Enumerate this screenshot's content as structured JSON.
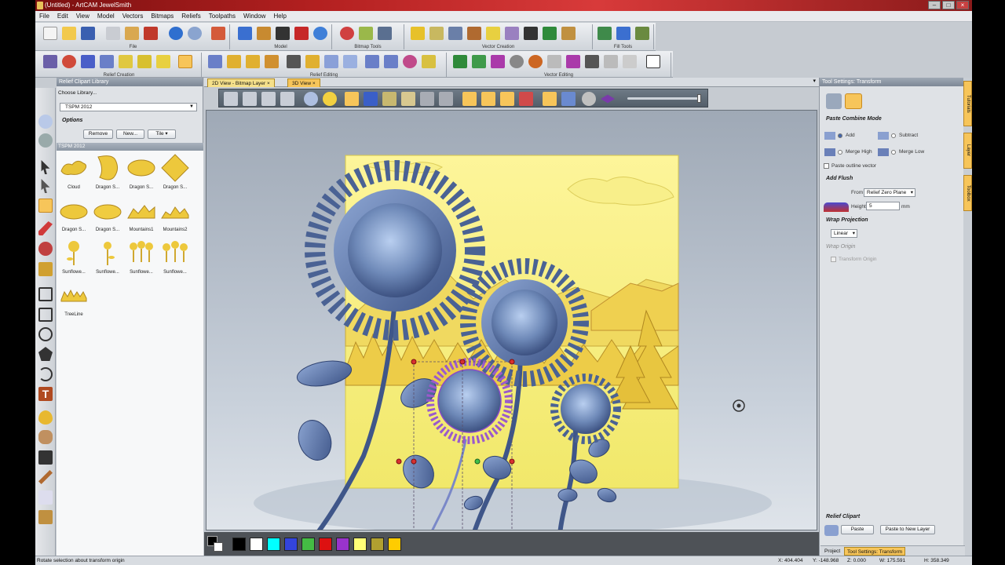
{
  "window": {
    "title": "(Untitled) - ArtCAM JewelSmith"
  },
  "menu": [
    "File",
    "Edit",
    "View",
    "Model",
    "Vectors",
    "Bitmaps",
    "Reliefs",
    "Toolpaths",
    "Window",
    "Help"
  ],
  "toolbar_groups": {
    "row1": [
      "File",
      "Model",
      "Bitmap Tools",
      "Vector Creation",
      "Fill Tools"
    ],
    "row2": [
      "Relief Creation",
      "Relief Editing",
      "Vector Editing"
    ]
  },
  "library": {
    "panel_title": "Relief Clipart Library",
    "choose_label": "Choose Library...",
    "selected_library": "TSPM 2012",
    "options_label": "Options",
    "remove_label": "Remove",
    "new_label": "New...",
    "tile_label": "Tile",
    "section_label": "TSPM 2012",
    "items": [
      {
        "name": "Cloud",
        "icon": "cloud-relief"
      },
      {
        "name": "Dragon S...",
        "icon": "dragon-relief"
      },
      {
        "name": "Dragon S...",
        "icon": "dragon-relief"
      },
      {
        "name": "Dragon S...",
        "icon": "dragon-relief"
      },
      {
        "name": "Dragon S...",
        "icon": "dragon-relief"
      },
      {
        "name": "Dragon S...",
        "icon": "dragon-relief"
      },
      {
        "name": "Mountains1",
        "icon": "mountain-relief"
      },
      {
        "name": "Mountains2",
        "icon": "mountain-relief"
      },
      {
        "name": "Sunflowe...",
        "icon": "sunflower-relief"
      },
      {
        "name": "Sunflowe...",
        "icon": "sunflower-relief"
      },
      {
        "name": "Sunflowe...",
        "icon": "sunflower-relief"
      },
      {
        "name": "Sunflowe...",
        "icon": "sunflower-relief"
      },
      {
        "name": "TreeLine",
        "icon": "treeline-relief"
      }
    ]
  },
  "view_tabs": {
    "tab1": "2D View - Bitmap Layer",
    "tab2": "3D View"
  },
  "palette_colors": [
    "#000000",
    "#ffffff",
    "#00ffff",
    "#3344dd",
    "#44bb44",
    "#dd1111",
    "#9933cc",
    "#ffff77",
    "#b0a030",
    "#ffcc00"
  ],
  "tool_settings": {
    "panel_title": "Tool Settings: Transform",
    "paste_combine_mode": "Paste Combine Mode",
    "add": "Add",
    "subtract": "Subtract",
    "merge_high": "Merge High",
    "merge_low": "Merge Low",
    "paste_outline": "Paste outline vector",
    "add_flush": "Add Flush",
    "from_label": "From",
    "from_value": "Relief Zero Plane",
    "height_label": "Height",
    "height_value": "5",
    "height_unit": "mm",
    "wrap_projection": "Wrap Projection",
    "wrap_value": "Linear",
    "wrap_origin": "Wrap Origin",
    "transform_origin": "Transform Origin",
    "relief_clipart": "Relief Clipart",
    "paste_label": "Paste",
    "paste_new_layer_label": "Paste to New Layer"
  },
  "side_tabs": [
    "Tutorials",
    "Layer",
    "Toolbox"
  ],
  "bottom_tabs": {
    "project": "Project",
    "tool_settings": "Tool Settings: Transform"
  },
  "status": {
    "message": "Rotate selection about transform origin",
    "x": "X: 404.404",
    "y": "Y: -148.968",
    "z": "Z: 0.000",
    "w": "W: 175.591",
    "h": "H: 358.349"
  },
  "colors": {
    "accent": "#f7c55a",
    "relief_yellow": "#f5ee7a",
    "relief_blue": "#56719e"
  }
}
